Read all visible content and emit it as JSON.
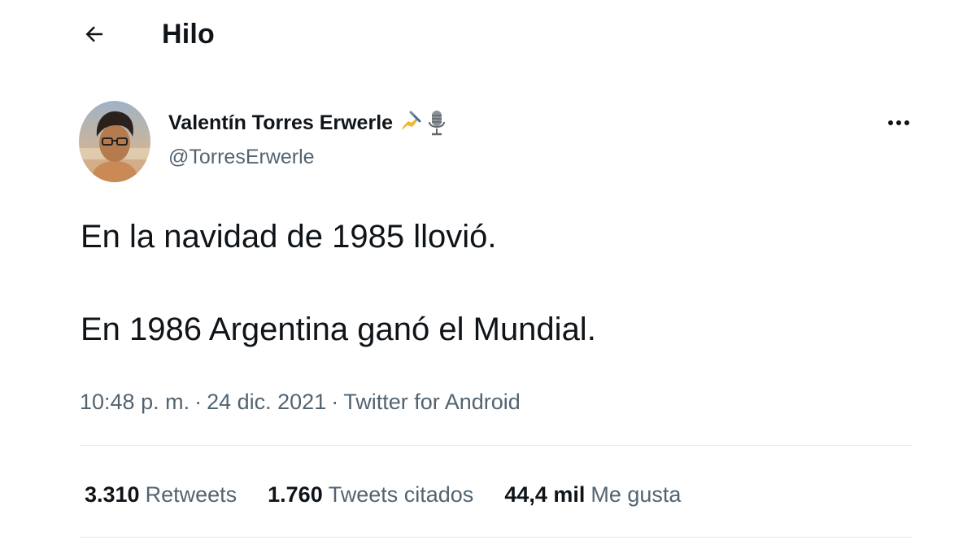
{
  "header": {
    "title": "Hilo",
    "back_icon": "arrow-left-icon"
  },
  "tweet": {
    "author": {
      "name": "Valentín Torres Erwerle",
      "name_emoji_1": "writing-hand-icon",
      "name_emoji_2": "microphone-icon",
      "handle": "@TorresErwerle"
    },
    "more_icon": "more-horizontal-icon",
    "text": [
      "En la navidad de 1985 llovió.",
      "En 1986 Argentina ganó el Mundial."
    ],
    "meta": {
      "time": "10:48 p. m.",
      "separator": "·",
      "date": "24 dic. 2021",
      "source": "Twitter for Android"
    },
    "stats": [
      {
        "value": "3.310",
        "label": "Retweets"
      },
      {
        "value": "1.760",
        "label": "Tweets citados"
      },
      {
        "value": "44,4 mil",
        "label": "Me gusta"
      }
    ]
  },
  "colors": {
    "text_primary": "#0f1419",
    "text_secondary": "#536471",
    "divider": "#e4e8eb",
    "background": "#ffffff"
  }
}
